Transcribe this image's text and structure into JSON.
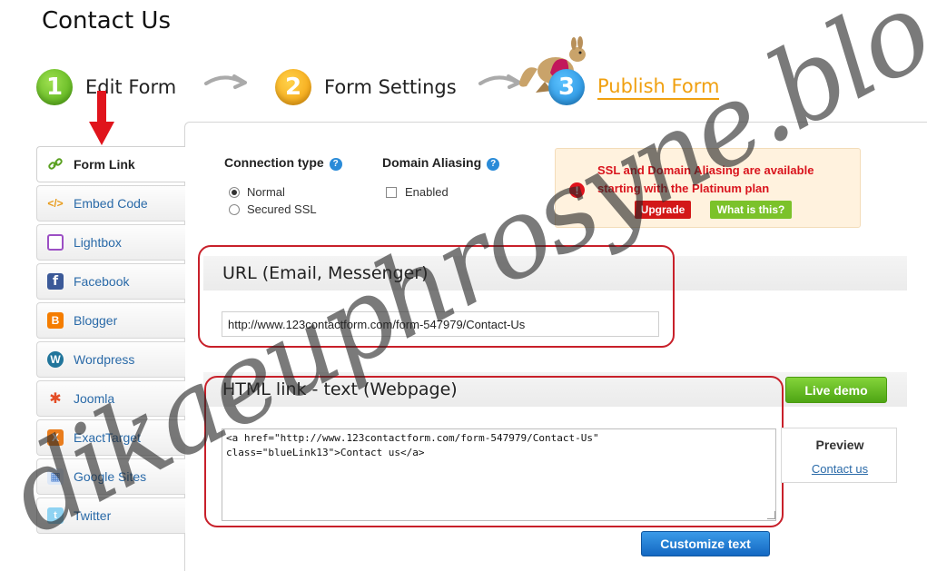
{
  "page": {
    "title": "Contact Us"
  },
  "steps": [
    {
      "num": "1",
      "label": "Edit Form"
    },
    {
      "num": "2",
      "label": "Form Settings"
    },
    {
      "num": "3",
      "label": "Publish Form"
    }
  ],
  "sidebar": {
    "items": [
      {
        "label": "Form Link",
        "icon": "link-icon",
        "active": true
      },
      {
        "label": "Embed Code",
        "icon": "code-icon"
      },
      {
        "label": "Lightbox",
        "icon": "lightbox-icon"
      },
      {
        "label": "Facebook",
        "icon": "facebook-icon"
      },
      {
        "label": "Blogger",
        "icon": "blogger-icon"
      },
      {
        "label": "Wordpress",
        "icon": "wordpress-icon"
      },
      {
        "label": "Joomla",
        "icon": "joomla-icon"
      },
      {
        "label": "ExactTarget",
        "icon": "exacttarget-icon"
      },
      {
        "label": "Google Sites",
        "icon": "google-sites-icon"
      },
      {
        "label": "Twitter",
        "icon": "twitter-icon"
      }
    ]
  },
  "connection": {
    "title": "Connection type",
    "options": [
      {
        "label": "Normal",
        "checked": true
      },
      {
        "label": "Secured SSL",
        "checked": false
      }
    ]
  },
  "domain_aliasing": {
    "title": "Domain Aliasing",
    "enabled_label": "Enabled",
    "enabled": false
  },
  "ssl_notice": {
    "text": "SSL and Domain Aliasing are available starting with the Platinum plan",
    "upgrade_label": "Upgrade",
    "what_label": "What is this?"
  },
  "url_section": {
    "title": "URL (Email, Messenger)",
    "url": "http://www.123contactform.com/form-547979/Contact-Us"
  },
  "html_section": {
    "title": "HTML link - text (Webpage)",
    "code": "<a href=\"http://www.123contactform.com/form-547979/Contact-Us\"\nclass=\"blueLink13\">Contact us</a>",
    "live_demo_label": "Live demo",
    "preview_title": "Preview",
    "preview_link": "Contact us",
    "customize_label": "Customize text"
  },
  "watermark": {
    "text": "dikaeuphrosyne.blogspot.com"
  },
  "colors": {
    "link_blue": "#2a6aa8",
    "annotation_red": "#c8202a",
    "ssl_red": "#d9141d",
    "green_button": "#5cb31c",
    "blue_button": "#1a78d0",
    "publish_orange": "#f0a010"
  }
}
